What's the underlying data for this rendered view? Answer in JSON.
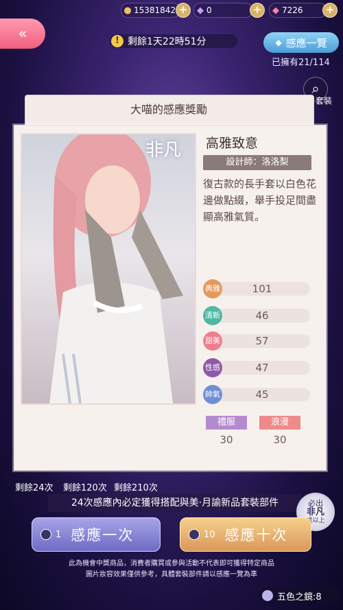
{
  "resources": {
    "coins": {
      "icon": "cat-coin-icon",
      "value": "15381842"
    },
    "diamond": {
      "icon": "diamond-icon",
      "value": "0"
    },
    "pink_diamond": {
      "icon": "pink-diamond-icon",
      "value": "7226"
    }
  },
  "back_icon": "«",
  "timer": {
    "warn_symbol": "!",
    "text": "剩餘1天22時51分"
  },
  "overview_button": "感應一覽",
  "owned_text": "已擁有21/114",
  "side_tab_label": "套裝",
  "modal": {
    "title": "大喵的感應獎勵"
  },
  "item": {
    "rarity": "非凡",
    "name": "高雅致意",
    "designer": "設計師：洛洛梨",
    "description": "復古款的長手套以白色花邊做點綴，舉手投足間盡顯高雅氣質。"
  },
  "stats": [
    {
      "label": "典雅",
      "value": "101",
      "color": "#e39a5c"
    },
    {
      "label": "清新",
      "value": "46",
      "color": "#4fb8a4"
    },
    {
      "label": "甜美",
      "value": "57",
      "color": "#ee7f8e"
    },
    {
      "label": "性感",
      "value": "47",
      "color": "#8e5aa8"
    },
    {
      "label": "帥氣",
      "value": "45",
      "color": "#6d8fd8"
    }
  ],
  "tags": [
    {
      "label": "禮服",
      "value": "30",
      "color": "#b58bd0"
    },
    {
      "label": "浪漫",
      "value": "30",
      "color": "#ee8a8a"
    }
  ],
  "remaining": [
    "剩餘24次",
    "剩餘120次",
    "剩餘210次"
  ],
  "banner_text": "24次感應內必定獲得搭配與美·月諭新品套裝部件",
  "seal": {
    "line1": "必出",
    "line2": "非凡",
    "line3": "或以上"
  },
  "draw_one": {
    "cost": "1",
    "label": "感應一次"
  },
  "draw_ten": {
    "cost": "10",
    "label": "感應十次"
  },
  "disclaimer": [
    "此為機會中獎商品，消費者購買或參與活動不代表即可獲得特定商品",
    "圖片妝容效果僅供參考，具體套裝部件請以感應一覽為準"
  ],
  "mirror": {
    "text": "五色之鏡:8"
  },
  "colors": {
    "accent_pink": "#f0607f",
    "accent_blue": "#4a9ed8",
    "gold": "#d9985a"
  }
}
